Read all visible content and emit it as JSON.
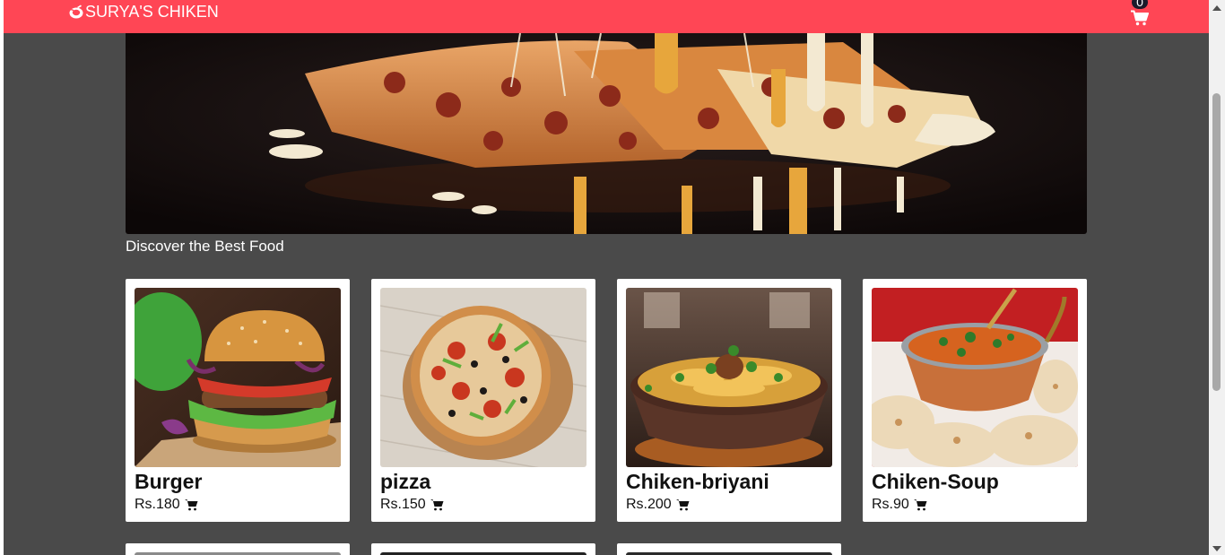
{
  "navbar": {
    "brand": "SURYA'S CHIKEN",
    "brand_icon": "chicken-logo-icon",
    "cart_count": "0",
    "cart_icon": "shopping-cart-icon",
    "color": "#ff4655"
  },
  "hero": {
    "image": "cheese-pizza-slices-photo"
  },
  "tagline": "Discover the Best Food",
  "products": [
    {
      "name": "Burger",
      "price": "Rs.180",
      "image": "burger-photo"
    },
    {
      "name": "pizza",
      "price": "Rs.150",
      "image": "pizza-photo"
    },
    {
      "name": "Chiken-briyani",
      "price": "Rs.200",
      "image": "chicken-biryani-photo"
    },
    {
      "name": "Chiken-Soup",
      "price": "Rs.90",
      "image": "chicken-soup-photo"
    }
  ],
  "colors": {
    "page_background": "#4a4a4a",
    "card_background": "#ffffff",
    "accent": "#ff4655"
  }
}
